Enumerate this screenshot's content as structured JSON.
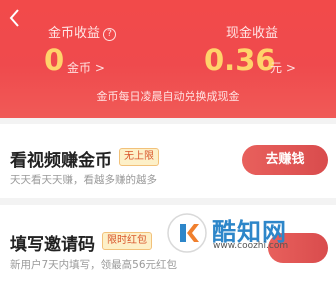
{
  "header": {
    "coin_label": "金币收益",
    "help_icon_text": "?",
    "coin_value": "0",
    "coin_unit": "金币 >",
    "cash_label": "现金收益",
    "cash_value": "0.36",
    "cash_unit": "元 >",
    "note": "金币每日凌晨自动兑换成现金"
  },
  "tasks": [
    {
      "title": "看视频赚金币",
      "tag": "无上限",
      "desc": "天天看天天赚，看越多赚的越多",
      "button": "去赚钱"
    },
    {
      "title": "填写邀请码",
      "tag": "限时红包",
      "desc": "新用户7天内填写，领最高56元红包"
    }
  ],
  "watermark": {
    "name": "酷知网",
    "url": "www.coozhi.com"
  },
  "colors": {
    "header_bg": "#ef4a4d",
    "value_gold": "#ffd36b",
    "button_red": "#e0554f",
    "watermark_blue": "#2d86c9"
  }
}
